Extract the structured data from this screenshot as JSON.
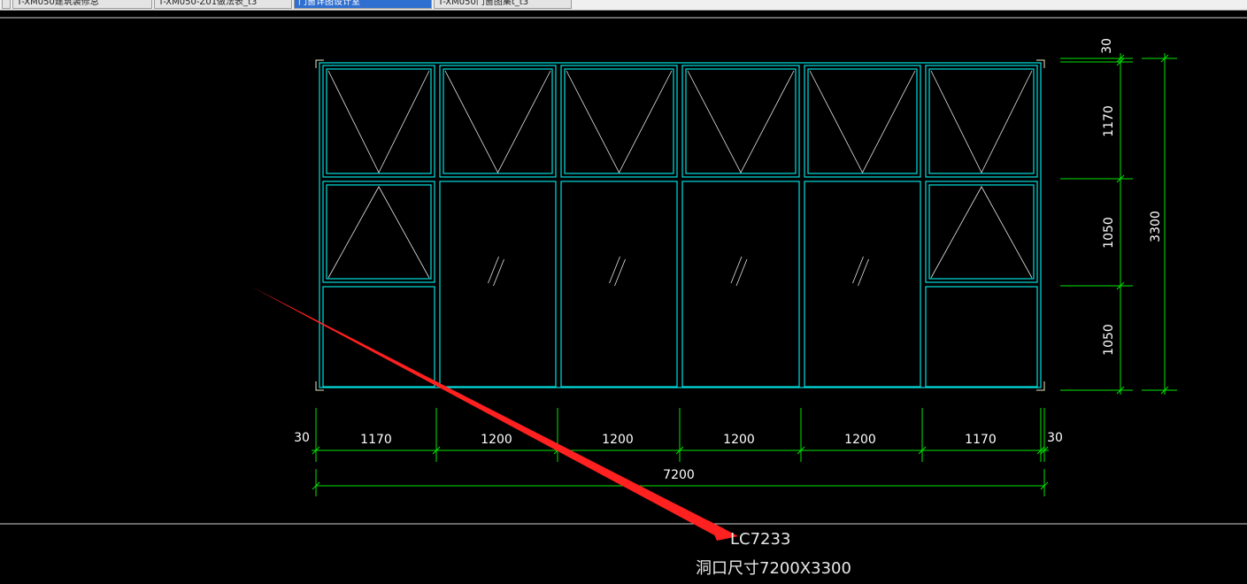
{
  "tabs": [
    {
      "label": "T-XM050建筑装修总"
    },
    {
      "label": "T-XM050-Z01做法表_t3"
    },
    {
      "label": "门窗详图设计室"
    },
    {
      "label": "T-XM050门窗图集t_t3"
    }
  ],
  "drawing": {
    "bottom_dims": {
      "segments": [
        "1170",
        "1200",
        "1200",
        "1200",
        "1200",
        "1170"
      ],
      "left_offset": "30",
      "right_offset": "30",
      "total": "7200"
    },
    "right_dims": {
      "top_offset": "30",
      "segments": [
        "1170",
        "1050",
        "1050"
      ],
      "total": "3300"
    },
    "label_code": "LC7233",
    "label_size": "洞口尺寸7200X3300",
    "colors": {
      "frame": "#00e0e0",
      "dimension": "#00e600",
      "text": "#ffffff",
      "arrow": "#ff2020"
    }
  }
}
